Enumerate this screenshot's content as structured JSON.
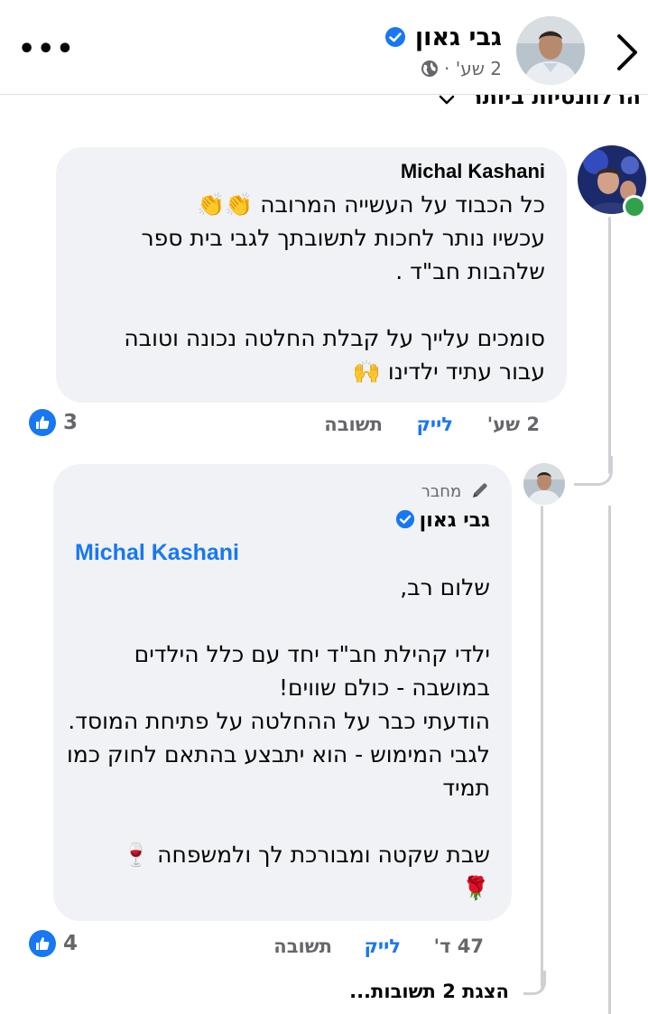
{
  "header": {
    "author_name": "גבי גאון",
    "meta_time": "2 שע' ·",
    "more_label": "•••"
  },
  "sort": {
    "label": "הרלוונטיות ביותר"
  },
  "comments": [
    {
      "author": "Michal Kashani",
      "text": "כל הכבוד על העשייה המרובה 👏👏\nעכשיו נותר לחכות לתשובתך לגבי בית ספר שלהבות חב\"ד .\n\nסומכים עלייך על קבלת החלטה נכונה וטובה עבור עתיד ילדינו 🙌",
      "time": "2 שע'",
      "like_label": "לייק",
      "reply_label": "תשובה",
      "reactions": "3"
    }
  ],
  "reply": {
    "badge_label": "מחבר",
    "author": "גבי גאון",
    "mention": "Michal Kashani",
    "text": "שלום רב,\n\nילדי קהילת חב\"ד יחד עם כלל הילדים במושבה - כולם שווים!\nהודעתי כבר על ההחלטה על פתיחת המוסד. לגבי המימוש - הוא יתבצע בהתאם לחוק כמו תמיד\n\nשבת שקטה ומבורכת לך ולמשפחה 🍷\n🌹",
    "time": "47 ד'",
    "like_label": "לייק",
    "reply_label": "תשובה",
    "reactions": "4"
  },
  "see_replies": "הצגת 2 תשובות...",
  "colors": {
    "accent": "#1877f2",
    "bubble": "#f0f2f5",
    "online": "#31a24c",
    "muted": "#65676b"
  },
  "icons": [
    "chevron-left-icon",
    "more-icon",
    "verified-icon",
    "globe-icon",
    "chevron-down-icon",
    "like-icon",
    "pencil-icon"
  ]
}
